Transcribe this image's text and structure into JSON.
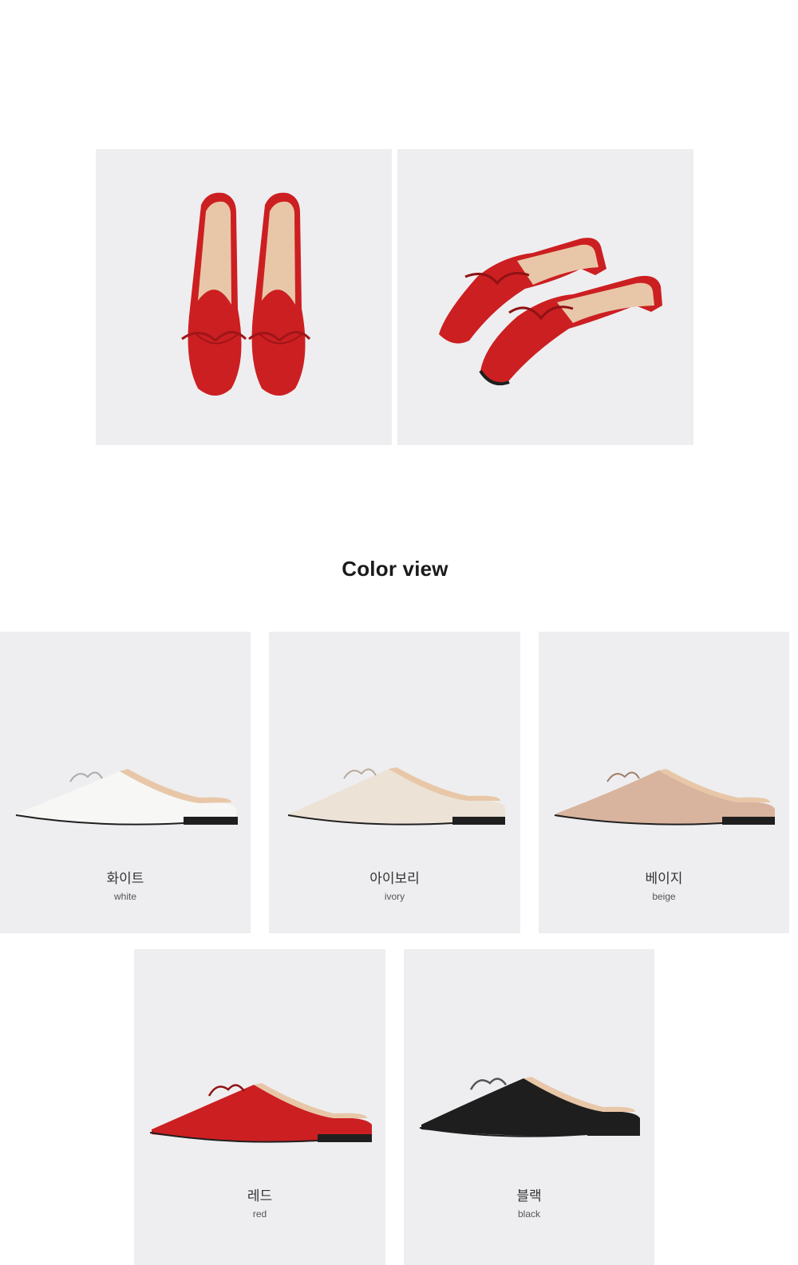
{
  "section_title": "Color view",
  "colors": [
    {
      "ko": "화이트",
      "en": "white",
      "upper": "#f7f7f6",
      "lining": "#e8c7a8",
      "sole": "#1f1f1f"
    },
    {
      "ko": "아이보리",
      "en": "ivory",
      "upper": "#ece2d6",
      "lining": "#e8c7a8",
      "sole": "#1f1f1f"
    },
    {
      "ko": "베이지",
      "en": "beige",
      "upper": "#d8b39e",
      "lining": "#e8c7a8",
      "sole": "#1f1f1f"
    },
    {
      "ko": "레드",
      "en": "red",
      "upper": "#cc1f22",
      "lining": "#e8c7a8",
      "sole": "#1f1f1f"
    },
    {
      "ko": "블랙",
      "en": "black",
      "upper": "#1e1e1e",
      "lining": "#e8c7a8",
      "sole": "#1f1f1f"
    }
  ],
  "hero_color": "#cc1f22",
  "panel_background": "#eeeef0"
}
